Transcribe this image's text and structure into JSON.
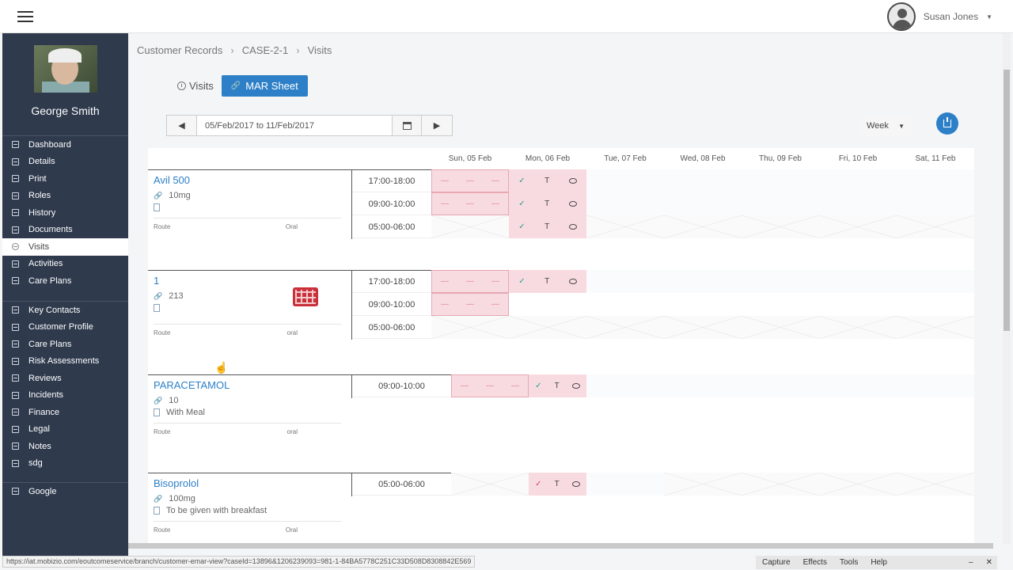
{
  "topbar": {
    "user_name": "Susan Jones"
  },
  "sidebar": {
    "profile_name": "George Smith",
    "group1": [
      "Dashboard",
      "Details",
      "Print",
      "Roles",
      "History",
      "Documents",
      "Visits",
      "Activities",
      "Care Plans"
    ],
    "group2": [
      "Key Contacts",
      "Customer Profile",
      "Care Plans",
      "Risk Assessments",
      "Reviews",
      "Incidents",
      "Finance",
      "Legal",
      "Notes",
      "sdg"
    ],
    "group3": [
      "Google"
    ],
    "active": "Visits"
  },
  "breadcrumb": [
    "Customer Records",
    "CASE-2-1",
    "Visits"
  ],
  "tabs": {
    "visits": "Visits",
    "mar": "MAR Sheet"
  },
  "datebar": {
    "range": "05/Feb/2017 to 11/Feb/2017"
  },
  "view_select": "Week",
  "days": [
    "Sun, 05 Feb",
    "Mon, 06 Feb",
    "Tue, 07 Feb",
    "Wed, 08 Feb",
    "Thu, 09 Feb",
    "Fri, 10 Feb",
    "Sat, 11 Feb"
  ],
  "meds": [
    {
      "name": "Avil 500",
      "dose": "10mg",
      "instruction": "",
      "route_label": "Route",
      "route": "Oral",
      "times": [
        "17:00-18:00",
        "09:00-10:00",
        "05:00-06:00"
      ]
    },
    {
      "name": "1",
      "dose": "213",
      "instruction": "",
      "route_label": "Route",
      "route": "oral",
      "times": [
        "17:00-18:00",
        "09:00-10:00",
        "05:00-06:00"
      ]
    },
    {
      "name": "PARACETAMOL",
      "dose": "10",
      "instruction": "With Meal",
      "route_label": "Route",
      "route": "oral",
      "times": [
        "09:00-10:00"
      ]
    },
    {
      "name": "Bisoprolol",
      "dose": "100mg",
      "instruction": "To be given with breakfast",
      "route_label": "Route",
      "route": "Oral",
      "times": [
        "05:00-06:00"
      ]
    }
  ],
  "marks": {
    "dash": "—",
    "check": "✓",
    "taken": "T"
  },
  "status_url": "https://iat.mobizio.com/eoutcomeservice/branch/customer-emar-view?caseId=13896&1206239093=981-1-84BA5778C251C33D508D8308842E569",
  "capture_bar": [
    "Capture",
    "Effects",
    "Tools",
    "Help"
  ]
}
